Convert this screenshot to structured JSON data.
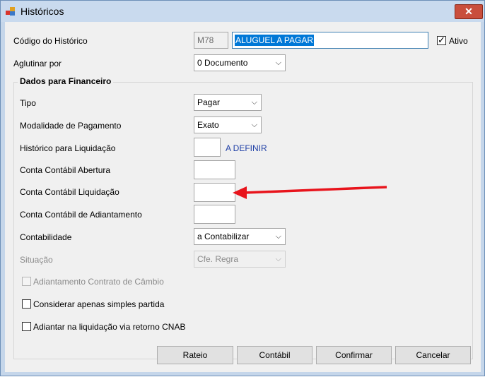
{
  "window": {
    "title": "Históricos",
    "close_glyph": "✕"
  },
  "form": {
    "codigo_label": "Código do Histórico",
    "codigo_value": "M78",
    "descricao_value": "ALUGUEL A PAGAR",
    "ativo_label": "Ativo",
    "ativo_checked": true,
    "aglutinar_label": "Aglutinar por",
    "aglutinar_value": "0 Documento"
  },
  "financeiro": {
    "group_title": "Dados para Financeiro",
    "tipo_label": "Tipo",
    "tipo_value": "Pagar",
    "modalidade_label": "Modalidade de Pagamento",
    "modalidade_value": "Exato",
    "historico_liq_label": "Histórico para Liquidação",
    "historico_liq_value": "",
    "historico_liq_link": "A DEFINIR",
    "conta_abertura_label": "Conta Contábil Abertura",
    "conta_liquidacao_label": "Conta Contábil Liquidação",
    "conta_adiantamento_label": "Conta Contábil de Adiantamento",
    "contabilidade_label": "Contabilidade",
    "contabilidade_value": "a Contabilizar",
    "situacao_label": "Situação",
    "situacao_value": "Cfe. Regra",
    "chk_adiantamento_cambio": "Adiantamento Contrato de Câmbio",
    "chk_simples_partida": "Considerar apenas simples partida",
    "chk_adiantar_cnab": "Adiantar na liquidação via retorno CNAB"
  },
  "buttons": {
    "rateio": "Rateio",
    "contabil": "Contábil",
    "confirmar": "Confirmar",
    "cancelar": "Cancelar"
  },
  "annotation": {
    "arrow_color": "#e8141c"
  },
  "icons": {
    "app": "app-window-icon",
    "dropdown": "chevron-down-icon"
  }
}
